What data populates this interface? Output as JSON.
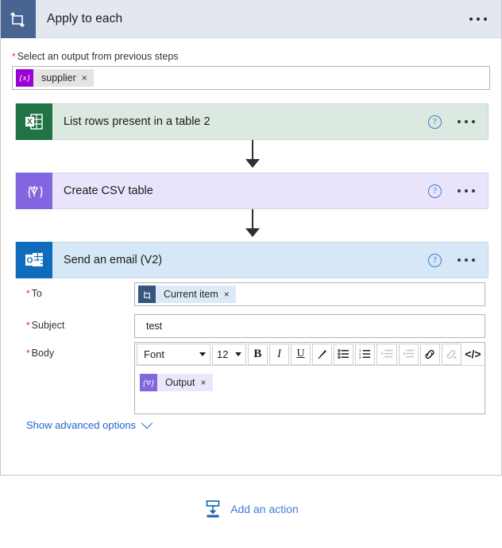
{
  "scope": {
    "title": "Apply to each",
    "icon": "loop-icon",
    "menu_icon": "ellipsis-icon",
    "select_output": {
      "label": "Select an output from previous steps",
      "required_marker": "*",
      "token": {
        "label": "supplier",
        "icon": "expression-token-icon",
        "icon_glyph": "{x}",
        "remove": "×"
      }
    }
  },
  "actions": [
    {
      "title": "List rows present in a table 2",
      "icon": "excel-icon",
      "icon_letter": "X",
      "card_color": "#dbe9e1",
      "icon_color": "#217346",
      "help_icon": "help-icon",
      "help_glyph": "?",
      "menu_icon": "ellipsis-icon"
    },
    {
      "title": "Create CSV table",
      "icon": "data-operation-icon",
      "icon_glyph": "{∇}",
      "card_color": "#e9e4fb",
      "icon_color": "#8266e0",
      "help_icon": "help-icon",
      "help_glyph": "?",
      "menu_icon": "ellipsis-icon"
    },
    {
      "title": "Send an email (V2)",
      "icon": "outlook-icon",
      "icon_letter": "O",
      "card_color": "#d6e8f7",
      "icon_color": "#0f6cbd",
      "help_icon": "help-icon",
      "help_glyph": "?",
      "menu_icon": "ellipsis-icon"
    }
  ],
  "email_form": {
    "to": {
      "label": "To",
      "required_marker": "*",
      "token": {
        "label": "Current item",
        "icon": "current-item-token-icon",
        "remove": "×"
      }
    },
    "subject": {
      "label": "Subject",
      "required_marker": "*",
      "value": "test"
    },
    "body": {
      "label": "Body",
      "required_marker": "*",
      "toolbar": {
        "font_name": "Font",
        "font_size": "12",
        "bold": "B",
        "italic": "I",
        "underline": "U",
        "code": "</>",
        "buttons": [
          {
            "name": "font-select",
            "enabled": true
          },
          {
            "name": "font-size-select",
            "enabled": true
          },
          {
            "name": "bold-button",
            "enabled": true
          },
          {
            "name": "italic-button",
            "enabled": true
          },
          {
            "name": "underline-button",
            "enabled": true
          },
          {
            "name": "text-highlight-button",
            "enabled": true
          },
          {
            "name": "bulleted-list-button",
            "enabled": true
          },
          {
            "name": "numbered-list-button",
            "enabled": true
          },
          {
            "name": "indent-increase-button",
            "enabled": false
          },
          {
            "name": "indent-decrease-button",
            "enabled": false
          },
          {
            "name": "insert-link-button",
            "enabled": true
          },
          {
            "name": "remove-link-button",
            "enabled": false
          },
          {
            "name": "code-view-button",
            "enabled": true
          }
        ]
      },
      "token": {
        "label": "Output",
        "icon": "data-operation-token-icon",
        "icon_glyph": "{∇}",
        "remove": "×"
      }
    },
    "advanced_options": {
      "label": "Show advanced options",
      "chevron": "chevron-down-icon"
    }
  },
  "footer": {
    "add_action": {
      "label": "Add an action",
      "icon": "add-action-icon"
    }
  },
  "colors": {
    "header_bg": "#e3e7ef",
    "header_icon_bg": "#486591",
    "link_blue": "#2266cc",
    "required_red": "#d13438",
    "connector": "#2e2e2e"
  }
}
